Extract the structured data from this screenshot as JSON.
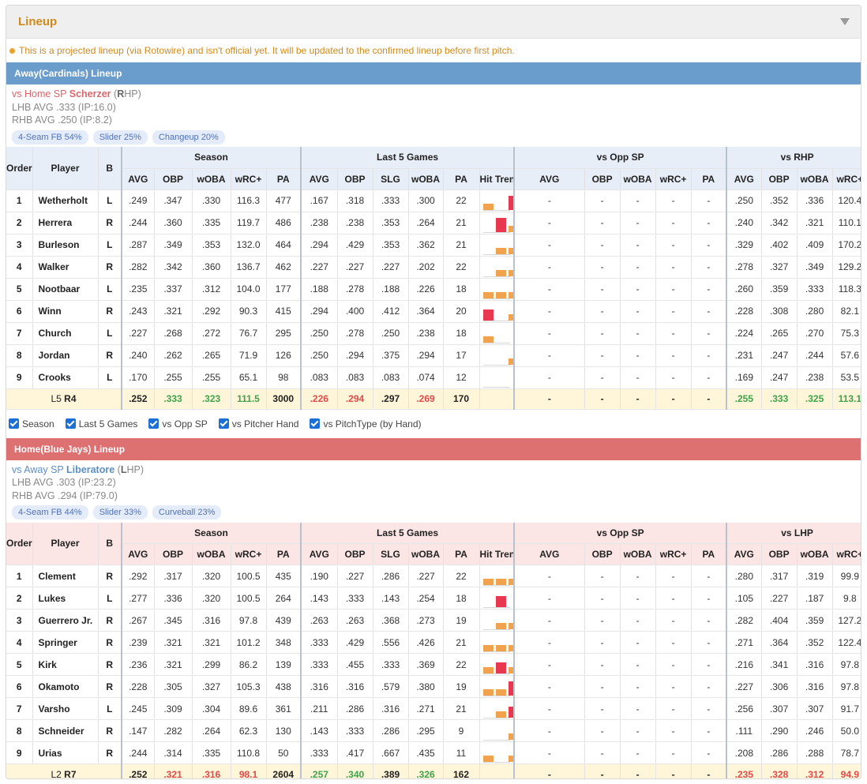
{
  "title": "Lineup",
  "notice": "This is a projected lineup (via Rotowire) and isn't official yet. It will be updated to the confirmed lineup before first pitch.",
  "colors": {
    "accent": "#d08a1a",
    "away_bar": "#6a9ccc",
    "home_bar": "#dd7070",
    "good": "#3fa34d",
    "bad": "#e24a4a",
    "trend_orange": "#f0a24c",
    "trend_red": "#e8384f"
  },
  "filters": [
    "Season",
    "Last 5 Games",
    "vs Opp SP",
    "vs Pitcher Hand",
    "vs PitchType (by Hand)"
  ],
  "headers": {
    "order": "Order",
    "player": "Player",
    "b": "B",
    "season": "Season",
    "last5": "Last 5 Games",
    "vsopp": "vs Opp SP",
    "season_cols": [
      "AVG",
      "OBP",
      "wOBA",
      "wRC+",
      "PA"
    ],
    "last5_cols": [
      "AVG",
      "OBP",
      "SLG",
      "wOBA",
      "PA",
      "Hit Trend"
    ],
    "vsopp_cols": [
      "AVG",
      "OBP",
      "wOBA",
      "wRC+",
      "PA"
    ],
    "vshand_cols": [
      "AVG",
      "OBP",
      "wOBA",
      "wRC+"
    ]
  },
  "away": {
    "bar_label": "Away(Cardinals) Lineup",
    "sp_label": "vs Home SP",
    "sp_name": "Scherzer",
    "sp_hand_letter": "R",
    "sp_hand_rest": "HP",
    "lhb": "LHB AVG .333 (IP:16.0)",
    "rhb": "RHB AVG .250 (IP:8.2)",
    "pitches": [
      "4-Seam FB 54%",
      "Slider 25%",
      "Changeup 20%"
    ],
    "vs_hand_label": "vs RHP",
    "players": [
      {
        "order": "1",
        "name": "Wetherholt",
        "b": "L",
        "season": [
          ".249",
          ".347",
          ".330",
          "116.3",
          "477"
        ],
        "last5": [
          ".167",
          ".318",
          ".333",
          ".300",
          "22"
        ],
        "trend": [
          [
            1,
            "o",
            0.3
          ],
          [
            3,
            "r",
            1.0
          ]
        ],
        "vsopp": [
          "-",
          "-",
          "-",
          "-",
          "-"
        ],
        "vshand": [
          ".250",
          ".352",
          ".336",
          "120.4"
        ]
      },
      {
        "order": "2",
        "name": "Herrera",
        "b": "R",
        "season": [
          ".244",
          ".360",
          ".335",
          "119.7",
          "486"
        ],
        "last5": [
          ".238",
          ".238",
          ".353",
          ".264",
          "21"
        ],
        "trend": [
          [
            2,
            "r",
            1.0
          ],
          [
            3,
            "o",
            0.3
          ],
          [
            4,
            "o",
            0.3
          ]
        ],
        "vsopp": [
          "-",
          "-",
          "-",
          "-",
          "-"
        ],
        "vshand": [
          ".240",
          ".342",
          ".321",
          "110.1"
        ]
      },
      {
        "order": "3",
        "name": "Burleson",
        "b": "L",
        "season": [
          ".287",
          ".349",
          ".353",
          "132.0",
          "464"
        ],
        "last5": [
          ".294",
          ".429",
          ".353",
          ".362",
          "21"
        ],
        "trend": [
          [
            2,
            "o",
            0.3
          ],
          [
            3,
            "o",
            0.3
          ],
          [
            4,
            "o",
            0.3
          ],
          [
            5,
            "r",
            0.7
          ]
        ],
        "vsopp": [
          "-",
          "-",
          "-",
          "-",
          "-"
        ],
        "vshand": [
          ".329",
          ".402",
          ".409",
          "170.2"
        ]
      },
      {
        "order": "4",
        "name": "Walker",
        "b": "R",
        "season": [
          ".282",
          ".342",
          ".360",
          "136.7",
          "462"
        ],
        "last5": [
          ".227",
          ".227",
          ".227",
          ".202",
          "22"
        ],
        "trend": [
          [
            2,
            "o",
            0.3
          ],
          [
            3,
            "o",
            0.3
          ],
          [
            4,
            "o",
            0.3
          ],
          [
            5,
            "r",
            0.7
          ]
        ],
        "vsopp": [
          "-",
          "-",
          "-",
          "-",
          "-"
        ],
        "vshand": [
          ".278",
          ".327",
          ".349",
          "129.2"
        ]
      },
      {
        "order": "5",
        "name": "Nootbaar",
        "b": "L",
        "season": [
          ".235",
          ".337",
          ".312",
          "104.0",
          "177"
        ],
        "last5": [
          ".188",
          ".278",
          ".188",
          ".226",
          "18"
        ],
        "trend": [
          [
            1,
            "o",
            0.3
          ],
          [
            2,
            "o",
            0.3
          ],
          [
            3,
            "o",
            0.3
          ],
          [
            5,
            "o",
            0.3
          ]
        ],
        "vsopp": [
          "-",
          "-",
          "-",
          "-",
          "-"
        ],
        "vshand": [
          ".260",
          ".359",
          ".333",
          "118.3"
        ]
      },
      {
        "order": "6",
        "name": "Winn",
        "b": "R",
        "season": [
          ".243",
          ".321",
          ".292",
          "90.3",
          "415"
        ],
        "last5": [
          ".294",
          ".400",
          ".412",
          ".364",
          "20"
        ],
        "trend": [
          [
            1,
            "r",
            0.7
          ],
          [
            3,
            "o",
            0.3
          ],
          [
            4,
            "o",
            0.3
          ],
          [
            5,
            "o",
            0.3
          ]
        ],
        "vsopp": [
          "-",
          "-",
          "-",
          "-",
          "-"
        ],
        "vshand": [
          ".228",
          ".308",
          ".280",
          "82.1"
        ]
      },
      {
        "order": "7",
        "name": "Church",
        "b": "L",
        "season": [
          ".227",
          ".268",
          ".272",
          "76.7",
          "295"
        ],
        "last5": [
          ".250",
          ".278",
          ".250",
          ".238",
          "18"
        ],
        "trend": [
          [
            1,
            "o",
            0.3
          ],
          [
            4,
            "r",
            0.7
          ],
          [
            5,
            "o",
            0.3
          ]
        ],
        "vsopp": [
          "-",
          "-",
          "-",
          "-",
          "-"
        ],
        "vshand": [
          ".224",
          ".265",
          ".270",
          "75.3"
        ]
      },
      {
        "order": "8",
        "name": "Jordan",
        "b": "R",
        "season": [
          ".240",
          ".262",
          ".265",
          "71.9",
          "126"
        ],
        "last5": [
          ".250",
          ".294",
          ".375",
          ".294",
          "17"
        ],
        "trend": [
          [
            3,
            "o",
            0.3
          ],
          [
            4,
            "o",
            0.3
          ],
          [
            5,
            "r",
            0.7
          ]
        ],
        "vsopp": [
          "-",
          "-",
          "-",
          "-",
          "-"
        ],
        "vshand": [
          ".231",
          ".247",
          ".244",
          "57.6"
        ]
      },
      {
        "order": "9",
        "name": "Crooks",
        "b": "L",
        "season": [
          ".170",
          ".255",
          ".255",
          "65.1",
          "98"
        ],
        "last5": [
          ".083",
          ".083",
          ".083",
          ".074",
          "12"
        ],
        "trend": [
          [
            5,
            "o",
            0.3
          ]
        ],
        "vsopp": [
          "-",
          "-",
          "-",
          "-",
          "-"
        ],
        "vshand": [
          ".169",
          ".247",
          ".238",
          "53.5"
        ]
      }
    ],
    "summary": {
      "lr_l": "L5",
      "lr_r": "R4",
      "season": [
        ".252",
        ".333",
        ".323",
        "111.5",
        "3000"
      ],
      "season_colors": [
        "black",
        "green",
        "green",
        "green",
        "black"
      ],
      "last5": [
        ".226",
        ".294",
        ".297",
        ".269",
        "170"
      ],
      "last5_colors": [
        "red",
        "red",
        "black",
        "red",
        "black"
      ],
      "vsopp": [
        "-",
        "-",
        "-",
        "-",
        "-"
      ],
      "vshand": [
        ".255",
        ".333",
        ".325",
        "113.1"
      ],
      "vshand_colors": [
        "green",
        "green",
        "green",
        "green"
      ]
    }
  },
  "home": {
    "bar_label": "Home(Blue Jays) Lineup",
    "sp_label": "vs Away SP",
    "sp_name": "Liberatore",
    "sp_hand_letter": "L",
    "sp_hand_rest": "HP",
    "lhb": "LHB AVG .303 (IP:23.2)",
    "rhb": "RHB AVG .294 (IP:79.0)",
    "pitches": [
      "4-Seam FB 44%",
      "Slider 33%",
      "Curveball 23%"
    ],
    "vs_hand_label": "vs LHP",
    "players": [
      {
        "order": "1",
        "name": "Clement",
        "b": "R",
        "season": [
          ".292",
          ".317",
          ".320",
          "100.5",
          "435"
        ],
        "last5": [
          ".190",
          ".227",
          ".286",
          ".227",
          "22"
        ],
        "trend": [
          [
            1,
            "o",
            0.3
          ],
          [
            2,
            "o",
            0.3
          ],
          [
            3,
            "o",
            0.3
          ],
          [
            4,
            "o",
            0.3
          ],
          [
            5,
            "o",
            0.3
          ]
        ],
        "vsopp": [
          "-",
          "-",
          "-",
          "-",
          "-"
        ],
        "vshand": [
          ".280",
          ".317",
          ".319",
          "99.9"
        ]
      },
      {
        "order": "2",
        "name": "Lukes",
        "b": "L",
        "season": [
          ".277",
          ".336",
          ".320",
          "100.5",
          "264"
        ],
        "last5": [
          ".143",
          ".333",
          ".143",
          ".254",
          "18"
        ],
        "trend": [
          [
            2,
            "r",
            0.7
          ]
        ],
        "vsopp": [
          "-",
          "-",
          "-",
          "-",
          "-"
        ],
        "vshand": [
          ".105",
          ".227",
          ".187",
          "9.8"
        ]
      },
      {
        "order": "3",
        "name": "Guerrero Jr.",
        "b": "R",
        "season": [
          ".267",
          ".345",
          ".316",
          "97.8",
          "439"
        ],
        "last5": [
          ".263",
          ".263",
          ".368",
          ".273",
          "19"
        ],
        "trend": [
          [
            2,
            "o",
            0.3
          ],
          [
            3,
            "o",
            0.3
          ],
          [
            4,
            "o",
            0.3
          ],
          [
            5,
            "r",
            0.7
          ]
        ],
        "vsopp": [
          "-",
          "-",
          "-",
          "-",
          "-"
        ],
        "vshand": [
          ".282",
          ".404",
          ".359",
          "127.2"
        ]
      },
      {
        "order": "4",
        "name": "Springer",
        "b": "R",
        "season": [
          ".239",
          ".321",
          ".321",
          "101.2",
          "348"
        ],
        "last5": [
          ".333",
          ".429",
          ".556",
          ".426",
          "21"
        ],
        "trend": [
          [
            1,
            "o",
            0.3
          ],
          [
            2,
            "o",
            0.3
          ],
          [
            3,
            "o",
            0.3
          ],
          [
            4,
            "o",
            0.3
          ],
          [
            5,
            "r",
            0.7
          ]
        ],
        "vsopp": [
          "-",
          "-",
          "-",
          "-",
          "-"
        ],
        "vshand": [
          ".271",
          ".364",
          ".352",
          "122.4"
        ]
      },
      {
        "order": "5",
        "name": "Kirk",
        "b": "R",
        "season": [
          ".236",
          ".321",
          ".299",
          "86.2",
          "139"
        ],
        "last5": [
          ".333",
          ".455",
          ".333",
          ".369",
          "22"
        ],
        "trend": [
          [
            1,
            "o",
            0.3
          ],
          [
            2,
            "r",
            0.7
          ],
          [
            3,
            "o",
            0.3
          ],
          [
            4,
            "r",
            0.7
          ],
          [
            5,
            "o",
            0.3
          ]
        ],
        "vsopp": [
          "-",
          "-",
          "-",
          "-",
          "-"
        ],
        "vshand": [
          ".216",
          ".341",
          ".316",
          "97.8"
        ]
      },
      {
        "order": "6",
        "name": "Okamoto",
        "b": "R",
        "season": [
          ".228",
          ".305",
          ".327",
          "105.3",
          "438"
        ],
        "last5": [
          ".316",
          ".316",
          ".579",
          ".380",
          "19"
        ],
        "trend": [
          [
            1,
            "o",
            0.3
          ],
          [
            2,
            "o",
            0.3
          ],
          [
            3,
            "r",
            1.0
          ],
          [
            4,
            "o",
            0.5
          ]
        ],
        "vsopp": [
          "-",
          "-",
          "-",
          "-",
          "-"
        ],
        "vshand": [
          ".227",
          ".306",
          ".316",
          "97.8"
        ]
      },
      {
        "order": "7",
        "name": "Varsho",
        "b": "L",
        "season": [
          ".245",
          ".309",
          ".304",
          "89.6",
          "361"
        ],
        "last5": [
          ".211",
          ".286",
          ".316",
          ".271",
          "21"
        ],
        "trend": [
          [
            2,
            "o",
            0.3
          ],
          [
            3,
            "r",
            0.7
          ],
          [
            4,
            "o",
            0.3
          ]
        ],
        "vsopp": [
          "-",
          "-",
          "-",
          "-",
          "-"
        ],
        "vshand": [
          ".256",
          ".307",
          ".307",
          "91.7"
        ]
      },
      {
        "order": "8",
        "name": "Schneider",
        "b": "R",
        "season": [
          ".147",
          ".282",
          ".264",
          "62.3",
          "130"
        ],
        "last5": [
          ".143",
          ".333",
          ".286",
          ".295",
          "9"
        ],
        "trend": [
          [
            3,
            "o",
            0.3
          ]
        ],
        "vsopp": [
          "-",
          "-",
          "-",
          "-",
          "-"
        ],
        "vshand": [
          ".111",
          ".290",
          ".246",
          "50.0"
        ]
      },
      {
        "order": "9",
        "name": "Urias",
        "b": "R",
        "season": [
          ".244",
          ".314",
          ".335",
          "110.8",
          "50"
        ],
        "last5": [
          ".333",
          ".417",
          ".667",
          ".435",
          "11"
        ],
        "trend": [
          [
            1,
            "o",
            0.3
          ],
          [
            3,
            "o",
            0.3
          ],
          [
            4,
            "o",
            0.3
          ],
          [
            5,
            "o",
            0.3
          ]
        ],
        "vsopp": [
          "-",
          "-",
          "-",
          "-",
          "-"
        ],
        "vshand": [
          ".208",
          ".286",
          ".288",
          "78.7"
        ]
      }
    ],
    "summary": {
      "lr_l": "L2",
      "lr_r": "R7",
      "season": [
        ".252",
        ".321",
        ".316",
        "98.1",
        "2604"
      ],
      "season_colors": [
        "black",
        "red",
        "red",
        "red",
        "black"
      ],
      "last5": [
        ".257",
        ".340",
        ".389",
        ".326",
        "162"
      ],
      "last5_colors": [
        "green",
        "green",
        "black",
        "green",
        "black"
      ],
      "vsopp": [
        "-",
        "-",
        "-",
        "-",
        "-"
      ],
      "vshand": [
        ".235",
        ".328",
        ".312",
        "94.9"
      ],
      "vshand_colors": [
        "red",
        "red",
        "red",
        "red"
      ]
    }
  }
}
